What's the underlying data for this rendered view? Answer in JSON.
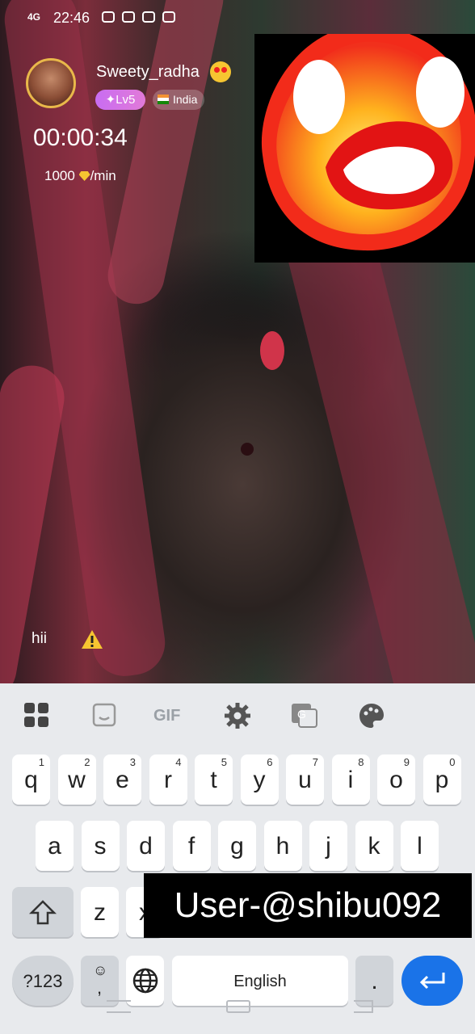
{
  "status_bar": {
    "signal": "4G",
    "time": "22:46"
  },
  "profile": {
    "username": "Sweety_radha",
    "level": "Lv5",
    "country": "India"
  },
  "call": {
    "duration": "00:00:34",
    "rate_amount": "1000",
    "rate_unit": "/min"
  },
  "chat": {
    "message": "hii"
  },
  "keyboard": {
    "toolbar": [
      "apps-icon",
      "sticker-icon",
      "gif-icon",
      "settings-icon",
      "translate-icon",
      "theme-icon"
    ],
    "gif_label": "GIF",
    "row1": [
      {
        "k": "q",
        "h": "1"
      },
      {
        "k": "w",
        "h": "2"
      },
      {
        "k": "e",
        "h": "3"
      },
      {
        "k": "r",
        "h": "4"
      },
      {
        "k": "t",
        "h": "5"
      },
      {
        "k": "y",
        "h": "6"
      },
      {
        "k": "u",
        "h": "7"
      },
      {
        "k": "i",
        "h": "8"
      },
      {
        "k": "o",
        "h": "9"
      },
      {
        "k": "p",
        "h": "0"
      }
    ],
    "row2": [
      "a",
      "s",
      "d",
      "f",
      "g",
      "h",
      "j",
      "k",
      "l"
    ],
    "row3": [
      "z",
      "x"
    ],
    "numbers_key": "?123",
    "comma_key": ",",
    "space_label": "English",
    "period_key": "."
  },
  "watermark": {
    "text": "User-@shibu092"
  },
  "colors": {
    "keyboard_bg": "#e8eaed",
    "enter_key": "#1a73e8",
    "level_badge": "#d26ff0"
  }
}
